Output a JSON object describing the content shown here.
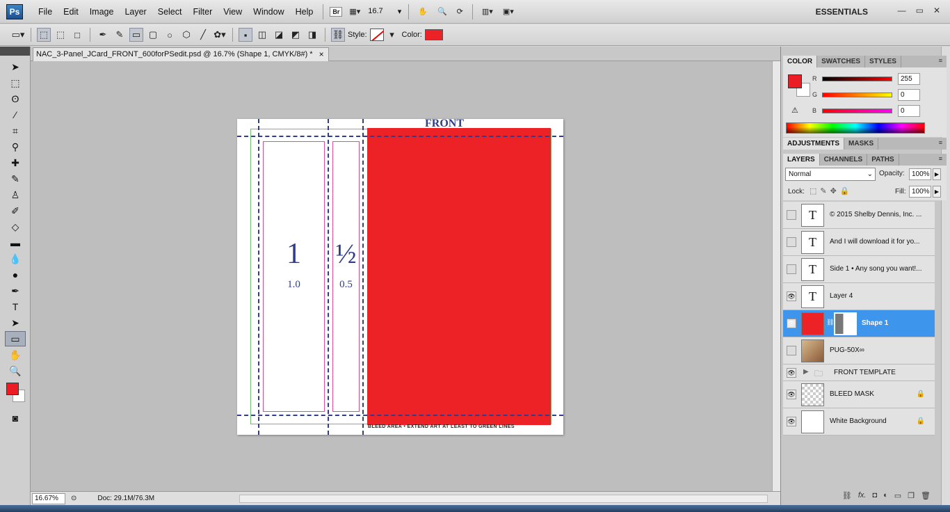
{
  "app": {
    "logo": "Ps",
    "workspace": "ESSENTIALS",
    "zoom_select": "16.7"
  },
  "menu": [
    "File",
    "Edit",
    "Image",
    "Layer",
    "Select",
    "Filter",
    "View",
    "Window",
    "Help"
  ],
  "menubar_buttons": {
    "bridge": "Br"
  },
  "window_controls": [
    "—",
    "▭",
    "✕"
  ],
  "options": {
    "style_label": "Style:",
    "color_label": "Color:",
    "color": "#ec2226"
  },
  "document": {
    "tab_title": "NAC_3-Panel_JCard_FRONT_600forPSedit.psd @ 16.7% (Shape 1, CMYK/8#) *",
    "tab_close": "×",
    "zoom": "16.67%",
    "doc_size": "Doc: 29.1M/76.3M",
    "artwork": {
      "front_label": "FRONT",
      "panel1_big": "1",
      "panel1_small": "1.0",
      "panel2_big": "½",
      "panel2_small": "0.5",
      "bleed_text": "BLEED AREA • EXTEND ART AT LEAST TO GREEN LINES",
      "shape_color": "#ec2226"
    }
  },
  "tools": [
    "move",
    "marquee",
    "lasso",
    "magic-wand",
    "crop",
    "eyedropper",
    "healing",
    "brush",
    "clone-stamp",
    "history-brush",
    "eraser",
    "gradient",
    "blur",
    "dodge",
    "pen",
    "type",
    "path-select",
    "rectangle",
    "hand",
    "zoom"
  ],
  "colors": {
    "foreground": "#ec1c24",
    "background": "#ffffff"
  },
  "panels": {
    "color_tabs": [
      "COLOR",
      "SWATCHES",
      "STYLES"
    ],
    "adjust_tabs": [
      "ADJUSTMENTS",
      "MASKS"
    ],
    "layer_tabs": [
      "LAYERS",
      "CHANNELS",
      "PATHS"
    ],
    "color": {
      "r_label": "R",
      "r_value": "255",
      "g_label": "G",
      "g_value": "0",
      "b_label": "B",
      "b_value": "0"
    },
    "layers": {
      "blend_mode": "Normal",
      "opacity_label": "Opacity:",
      "opacity": "100%",
      "lock_label": "Lock:",
      "fill_label": "Fill:",
      "fill": "100%",
      "items": [
        {
          "name": "© 2015 Shelby Dennis, Inc. ...",
          "thumb": "T",
          "visible": false
        },
        {
          "name": "And I will download it for yo...",
          "thumb": "T",
          "visible": false
        },
        {
          "name": "Side 1 • Any song you want!...",
          "thumb": "T",
          "visible": false
        },
        {
          "name": "Layer 4",
          "thumb": "T",
          "visible": true
        },
        {
          "name": "Shape 1",
          "thumb": "shape",
          "visible": true,
          "selected": true
        },
        {
          "name": "PUG-50X∞",
          "thumb": "image",
          "visible": false
        },
        {
          "name": "FRONT TEMPLATE",
          "thumb": "folder",
          "visible": true
        },
        {
          "name": "BLEED MASK",
          "thumb": "transparent",
          "visible": true,
          "locked": true
        },
        {
          "name": "White Background",
          "thumb": "white",
          "visible": true,
          "locked": true
        }
      ]
    }
  }
}
